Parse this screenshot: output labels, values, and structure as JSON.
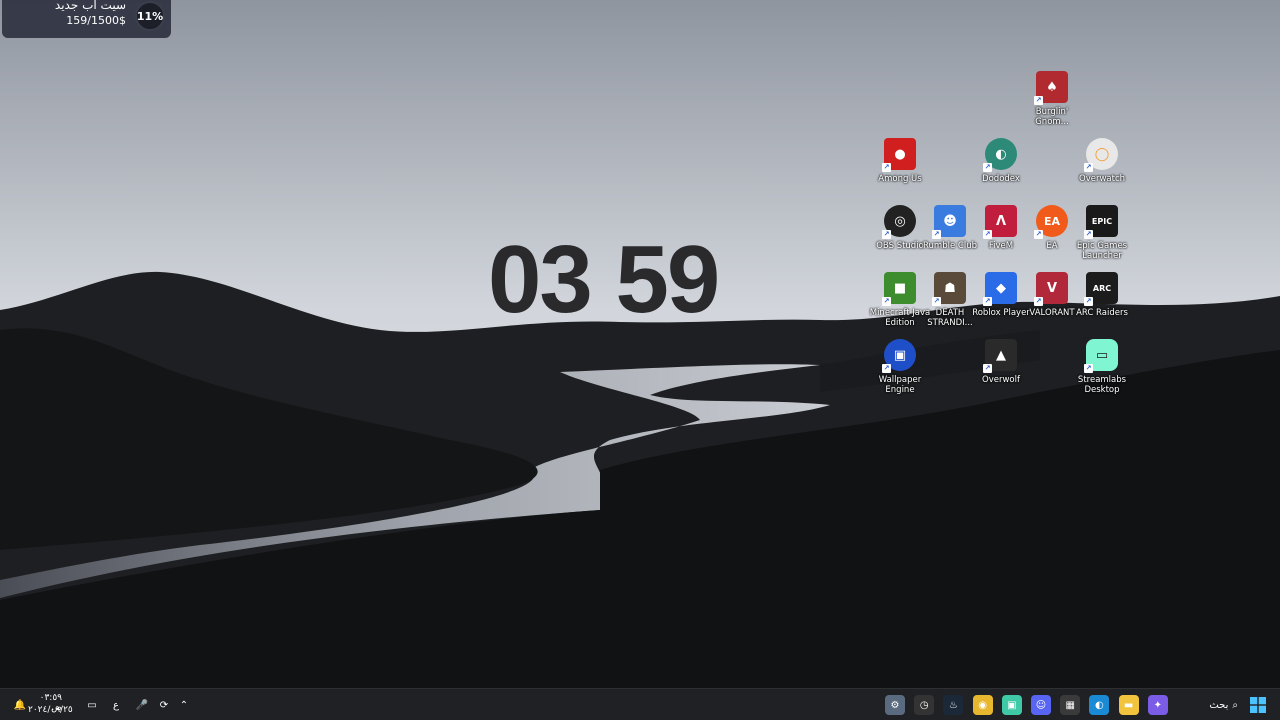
{
  "clock": {
    "time": "03 59"
  },
  "widget": {
    "title": "سيت أب جديد",
    "subtitle": "159/1500$",
    "percent": "11%"
  },
  "desktop_icons": [
    {
      "label": "Burglin' Gnom...",
      "icon": "gnome-icon",
      "color": "#b02a30"
    },
    {
      "label": "Among Us",
      "icon": "among-us-icon",
      "color": "#d11f1f"
    },
    {
      "label": "Dododex",
      "icon": "dododex-icon",
      "color": "#2e8a78"
    },
    {
      "label": "Overwatch",
      "icon": "overwatch-icon",
      "color": "#e8e8e8"
    },
    {
      "label": "OBS Studio",
      "icon": "obs-icon",
      "color": "#222222"
    },
    {
      "label": "Rumble Club",
      "icon": "rumble-club-icon",
      "color": "#3a7be0"
    },
    {
      "label": "FiveM",
      "icon": "fivem-icon",
      "color": "#c01e3c"
    },
    {
      "label": "EA",
      "icon": "ea-icon",
      "color": "#f05a1a"
    },
    {
      "label": "Epic Games Launcher",
      "icon": "epic-games-icon",
      "color": "#1a1a1a"
    },
    {
      "label": "Minecraft Java Edition",
      "icon": "minecraft-icon",
      "color": "#3d8c2e"
    },
    {
      "label": "DEATH STRANDI...",
      "icon": "death-stranding-icon",
      "color": "#5a4a3a"
    },
    {
      "label": "Roblox Player",
      "icon": "roblox-icon",
      "color": "#2a6be8"
    },
    {
      "label": "VALORANT",
      "icon": "valorant-icon",
      "color": "#b0283a"
    },
    {
      "label": "ARC Raiders",
      "icon": "arc-raiders-icon",
      "color": "#1c1c1c"
    },
    {
      "label": "Wallpaper Engine",
      "icon": "wallpaper-engine-icon",
      "color": "#1f4fc8"
    },
    {
      "label": "Overwolf",
      "icon": "overwolf-icon",
      "color": "#2a2a2a"
    },
    {
      "label": "Streamlabs Desktop",
      "icon": "streamlabs-icon",
      "color": "#80f5d2"
    }
  ],
  "taskbar": {
    "search_label": "بحث",
    "time": "٠٣:٥٩ ص",
    "date": "٢٠٢٤/٠٩/٢٥",
    "language": "ع",
    "pinned": [
      {
        "name": "settings-icon",
        "color": "#5a6b80"
      },
      {
        "name": "timer-app-icon",
        "color": "#333333"
      },
      {
        "name": "steam-icon",
        "color": "#1b2838"
      },
      {
        "name": "chrome-icon",
        "color": "#e8b730"
      },
      {
        "name": "streamlabs-taskbar-icon",
        "color": "#3fc9a6"
      },
      {
        "name": "discord-icon",
        "color": "#5865f2"
      },
      {
        "name": "store-icon",
        "color": "#3a3a3a"
      },
      {
        "name": "edge-icon",
        "color": "#1a8ad4"
      },
      {
        "name": "file-explorer-icon",
        "color": "#f2c33c"
      },
      {
        "name": "copilot-icon",
        "color": "#7b5ce6"
      }
    ]
  }
}
